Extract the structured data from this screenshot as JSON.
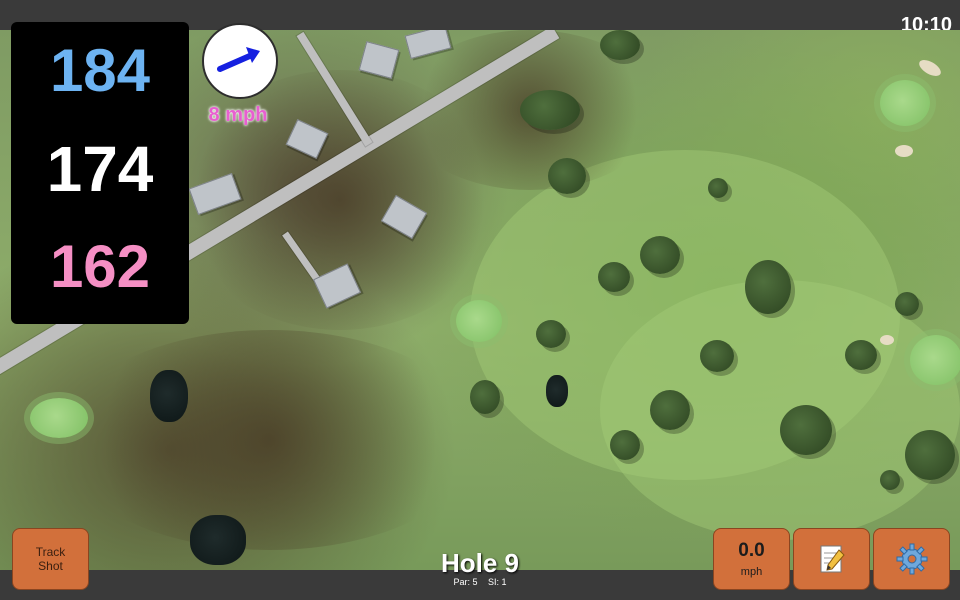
{
  "status": {
    "time": "10:10"
  },
  "distances": {
    "back": "184",
    "middle": "174",
    "front": "162"
  },
  "wind": {
    "speed_label": "8 mph",
    "direction_icon": "wind-arrow-icon"
  },
  "hole": {
    "title": "Hole 9",
    "par": "Par: 5",
    "stroke_index": "SI: 1"
  },
  "buttons": {
    "track_shot_line1": "Track",
    "track_shot_line2": "Shot",
    "speed_value": "0.0",
    "speed_unit": "mph",
    "notes_icon": "notes-icon",
    "settings_icon": "gear-icon"
  },
  "colors": {
    "back_distance": "#6db3f2",
    "middle_distance": "#ffffff",
    "front_distance": "#f58fc4",
    "wind_text": "#e85fd0",
    "button_orange": "#d2703b"
  }
}
